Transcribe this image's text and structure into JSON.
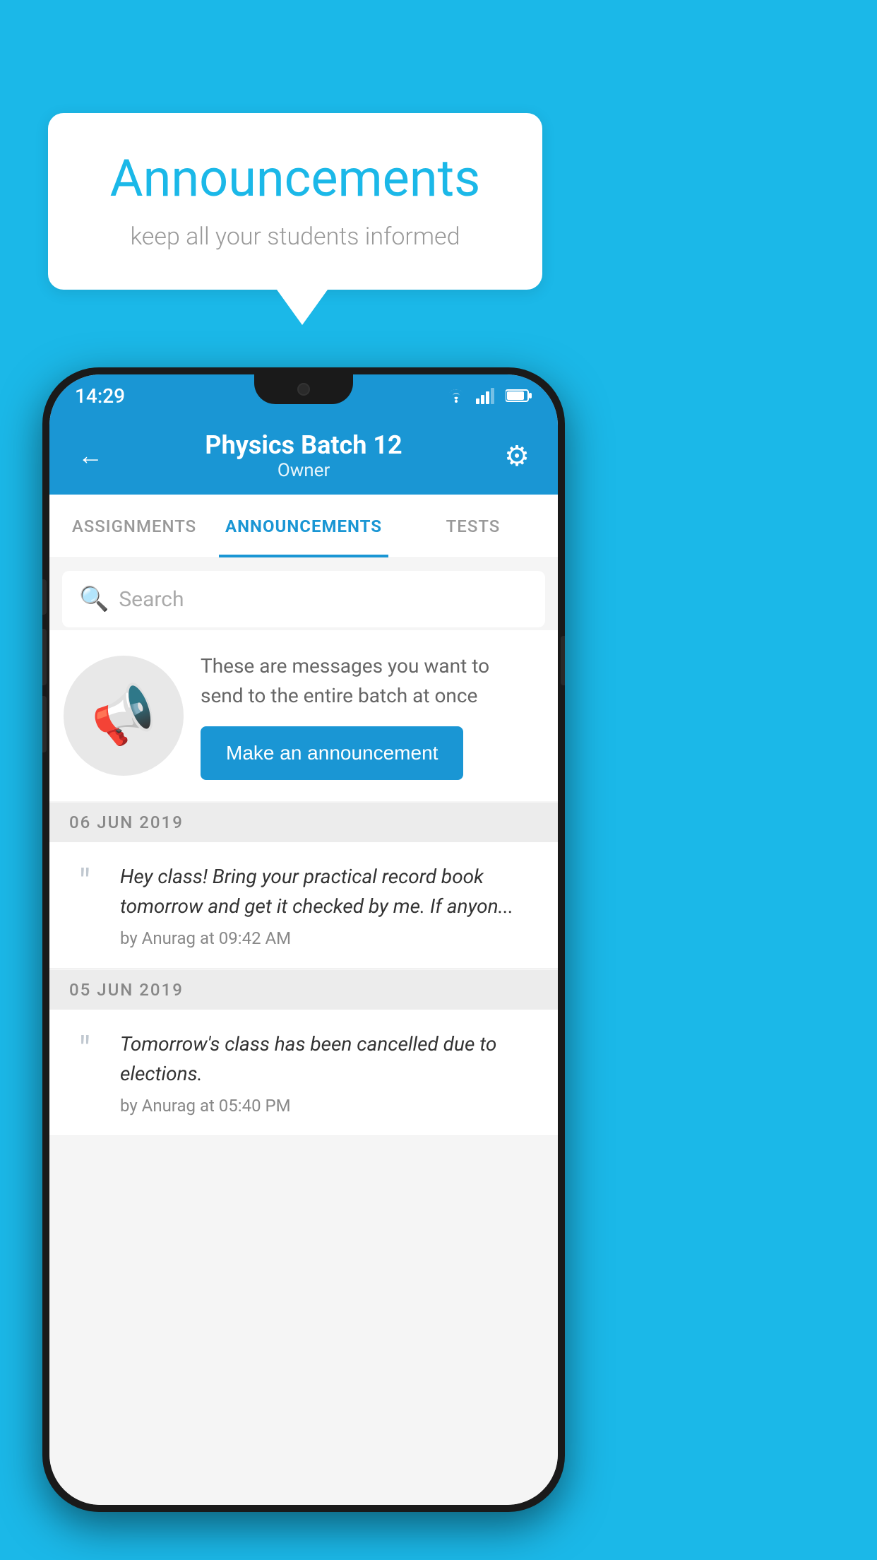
{
  "background_color": "#1bb8e8",
  "speech_bubble": {
    "title": "Announcements",
    "subtitle": "keep all your students informed"
  },
  "phone": {
    "status_bar": {
      "time": "14:29"
    },
    "app_bar": {
      "title": "Physics Batch 12",
      "subtitle": "Owner",
      "back_label": "←",
      "gear_label": "⚙"
    },
    "tabs": [
      {
        "label": "ASSIGNMENTS",
        "active": false
      },
      {
        "label": "ANNOUNCEMENTS",
        "active": true
      },
      {
        "label": "TESTS",
        "active": false
      }
    ],
    "search": {
      "placeholder": "Search"
    },
    "promo": {
      "text": "These are messages you want to send to the entire batch at once",
      "button_label": "Make an announcement"
    },
    "announcements": [
      {
        "date": "06  JUN  2019",
        "text": "Hey class! Bring your practical record book tomorrow and get it checked by me. If anyon...",
        "meta": "by Anurag at 09:42 AM"
      },
      {
        "date": "05  JUN  2019",
        "text": "Tomorrow's class has been cancelled due to elections.",
        "meta": "by Anurag at 05:40 PM"
      }
    ]
  }
}
